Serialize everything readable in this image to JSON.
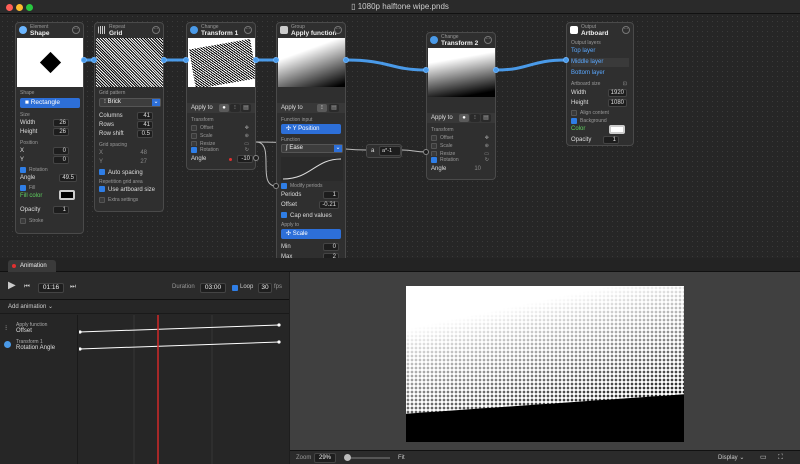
{
  "window": {
    "title": "1080p halftone wipe.pnds"
  },
  "nodes": {
    "shape": {
      "category": "Element",
      "name": "Shape",
      "shape_label": "Shape",
      "shape_value": "Rectangle",
      "size_label": "Size",
      "width_label": "Width",
      "width": "26",
      "height_label": "Height",
      "height": "26",
      "position_label": "Position",
      "x_label": "X",
      "x": "0",
      "y_label": "Y",
      "y": "0",
      "rotation_label": "Rotation",
      "angle_label": "Angle",
      "angle": "49.5",
      "fill_label": "Fill",
      "fill_color_label": "Fill color",
      "opacity_label": "Opacity",
      "opacity": "1",
      "stroke_label": "Stroke"
    },
    "grid": {
      "category": "Repeat",
      "name": "Grid",
      "pattern_label": "Grid pattern",
      "pattern_value": "Brick",
      "columns_label": "Columns",
      "columns": "41",
      "rows_label": "Rows",
      "rows": "41",
      "rowshift_label": "Row shift",
      "rowshift": "0.5",
      "spacing_label": "Grid spacing",
      "x_label": "X",
      "x": "48",
      "y_label": "Y",
      "y": "27",
      "autospacing_label": "Auto spacing",
      "repetition_label": "Repetition grid area",
      "artboard_label": "Use artboard size",
      "extra_label": "Extra settings"
    },
    "transform1": {
      "category": "Change",
      "name": "Transform 1",
      "applyto_label": "Apply to",
      "transform_label": "Transform",
      "offset_label": "Offset",
      "scale_label": "Scale",
      "resize_label": "Resize",
      "rotation_label": "Rotation",
      "angle_label": "Angle",
      "angle": "-10"
    },
    "applyfn": {
      "category": "Group",
      "name": "Apply function",
      "applyto_label": "Apply to",
      "input_label": "Function input",
      "input_value": "Y Position",
      "function_label": "Function",
      "function_value": "Ease",
      "modify_label": "Modify periods",
      "periods_label": "Periods",
      "periods": "1",
      "offset_label": "Offset",
      "offset": "-0.21",
      "cap_label": "Cap end values",
      "applyto2_label": "Apply to",
      "applyto2_value": "Scale",
      "min_label": "Min",
      "min": "0",
      "max_label": "Max",
      "max": "2"
    },
    "expr": {
      "label": "a",
      "formula": "a*-1"
    },
    "transform2": {
      "category": "Change",
      "name": "Transform 2",
      "applyto_label": "Apply to",
      "transform_label": "Transform",
      "offset_label": "Offset",
      "scale_label": "Scale",
      "resize_label": "Resize",
      "rotation_label": "Rotation",
      "angle_label": "Angle",
      "angle": "10"
    },
    "artboard": {
      "category": "Output",
      "name": "Artboard",
      "layers_label": "Output layers",
      "top_layer": "Top layer",
      "middle_layer": "Middle layer",
      "bottom_layer": "Bottom layer",
      "size_label": "Artboard size",
      "width_label": "Width",
      "width": "1920",
      "height_label": "Height",
      "height": "1080",
      "align_label": "Align content",
      "background_label": "Background",
      "color_label": "Color",
      "opacity_label": "Opacity",
      "opacity": "1"
    }
  },
  "tabs": {
    "animation": "Animation"
  },
  "timeline": {
    "time": "01:16",
    "duration_label": "Duration",
    "duration": "03:00",
    "loop_label": "Loop",
    "fps": "30",
    "fps_label": "fps",
    "add_animation": "Add animation",
    "tracks": [
      {
        "node": "Apply function",
        "property": "Offset"
      },
      {
        "node": "Transform 1",
        "property": "Rotation Angle"
      }
    ]
  },
  "viewer": {
    "zoom_label": "Zoom",
    "zoom": "29%",
    "fit_label": "Fit",
    "display_label": "Display"
  }
}
